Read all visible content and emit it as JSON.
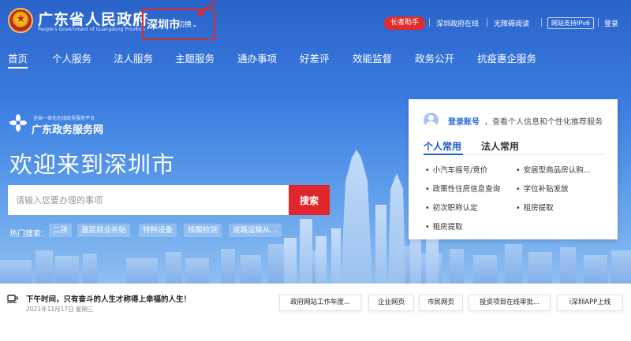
{
  "header": {
    "site_title": "广东省人民政府",
    "site_subtitle": "People's Government of Guangdong Province",
    "city": "深圳市",
    "city_switch": "切换⌄",
    "elder_helper": "长者助手",
    "links": [
      "深圳政府在线",
      "无障碍阅读"
    ],
    "ipv6": "网站支持IPv6",
    "login": "登录"
  },
  "nav": {
    "items": [
      "首页",
      "个人服务",
      "法人服务",
      "主题服务",
      "通办事项",
      "好差评",
      "效能监督",
      "政务公开",
      "抗疫惠企服务"
    ],
    "active_index": 0
  },
  "brand": {
    "small_text": "全国一体化在线政务服务平台",
    "name": "广东政务服务网"
  },
  "welcome": "欢迎来到深圳市",
  "search": {
    "placeholder": "请输入您要办理的事项",
    "button": "搜索"
  },
  "hot_search": {
    "label": "热门搜索：",
    "tags": [
      "二孩",
      "基层就业补贴",
      "特种设备",
      "核酸检测",
      "道路运输从..."
    ]
  },
  "panel": {
    "login_link": "登录账号",
    "login_desc": "，查看个人信息和个性化推荐服务",
    "tabs": [
      "个人常用",
      "法人常用"
    ],
    "active_tab": 0,
    "services_left": [
      "小汽车摇号/竞价",
      "政策性住房信息查询",
      "初次职称认定",
      "租房提取"
    ],
    "services_right": [
      "安居型商品房认购...",
      "学位补贴发放",
      "租房提取"
    ]
  },
  "bottom": {
    "greeting": "下午时间，只有奋斗的人生才称得上幸福的人生！",
    "date": "2021年11月17日 星期三",
    "quick_links": [
      "政府网站工作年度...",
      "企业网页",
      "市民网页",
      "投资项目在线审批...",
      "i深圳APP上线"
    ]
  },
  "colors": {
    "hero_blue": "#3a7be0",
    "accent_red": "#e0262b",
    "link_blue": "#2c6ad8"
  },
  "icons": {
    "logo": "national-emblem-icon",
    "brand": "gov-service-flower-icon",
    "user": "user-avatar-icon",
    "greeting": "coffee-cup-icon",
    "annotation": "red-arrow-annotation"
  }
}
